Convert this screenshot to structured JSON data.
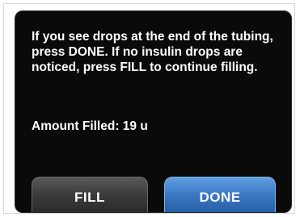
{
  "dialog": {
    "message": "If you see drops at the end of the tubing, press DONE. If no insulin drops are noticed, press FILL to continue filling.",
    "amount_text": "Amount Filled: 19 u"
  },
  "buttons": {
    "fill_label": "FILL",
    "done_label": "DONE"
  },
  "colors": {
    "screen_background": "#0a0a0a",
    "text": "#ffffff",
    "fill_button": "#3b3b3b",
    "done_button": "#3a78c4"
  }
}
